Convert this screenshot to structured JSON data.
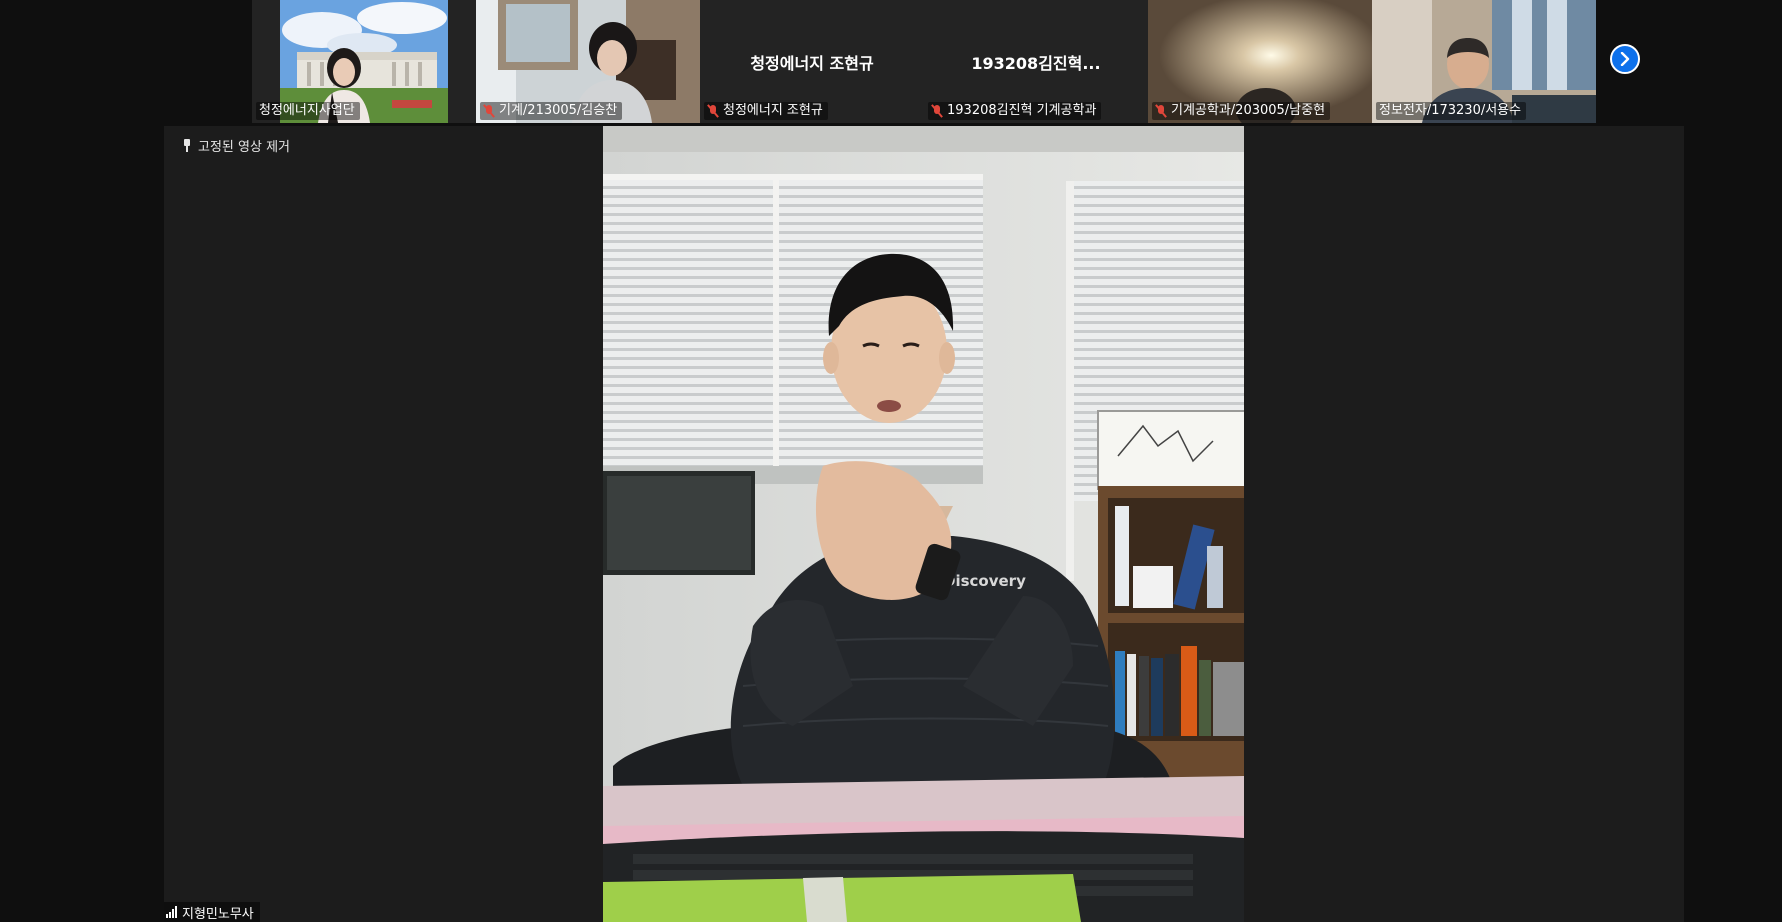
{
  "participants": [
    {
      "name": "청정에너지사업단",
      "muted": false,
      "video": "campus"
    },
    {
      "name": "기계/213005/김승찬",
      "muted": true,
      "video": "room"
    },
    {
      "name": "청정에너지 조현규",
      "center_label": "청정에너지 조현규",
      "muted": true,
      "video": "none"
    },
    {
      "name": "193208김진혁 기계공학과",
      "center_label": "193208김진혁...",
      "muted": true,
      "video": "none"
    },
    {
      "name": "기계공학과/203005/남중현",
      "muted": true,
      "video": "dim"
    },
    {
      "name": "정보전자/173230/서용수",
      "muted": false,
      "video": "man"
    }
  ],
  "controls": {
    "unpin_label": "고정된 영상 제거"
  },
  "main_speaker": {
    "name": "지형민노무사"
  },
  "colors": {
    "accent_blue": "#0e71eb",
    "muted_red": "#e0463a",
    "stage_bg": "#1c1c1c",
    "strip_bg": "#232323"
  }
}
